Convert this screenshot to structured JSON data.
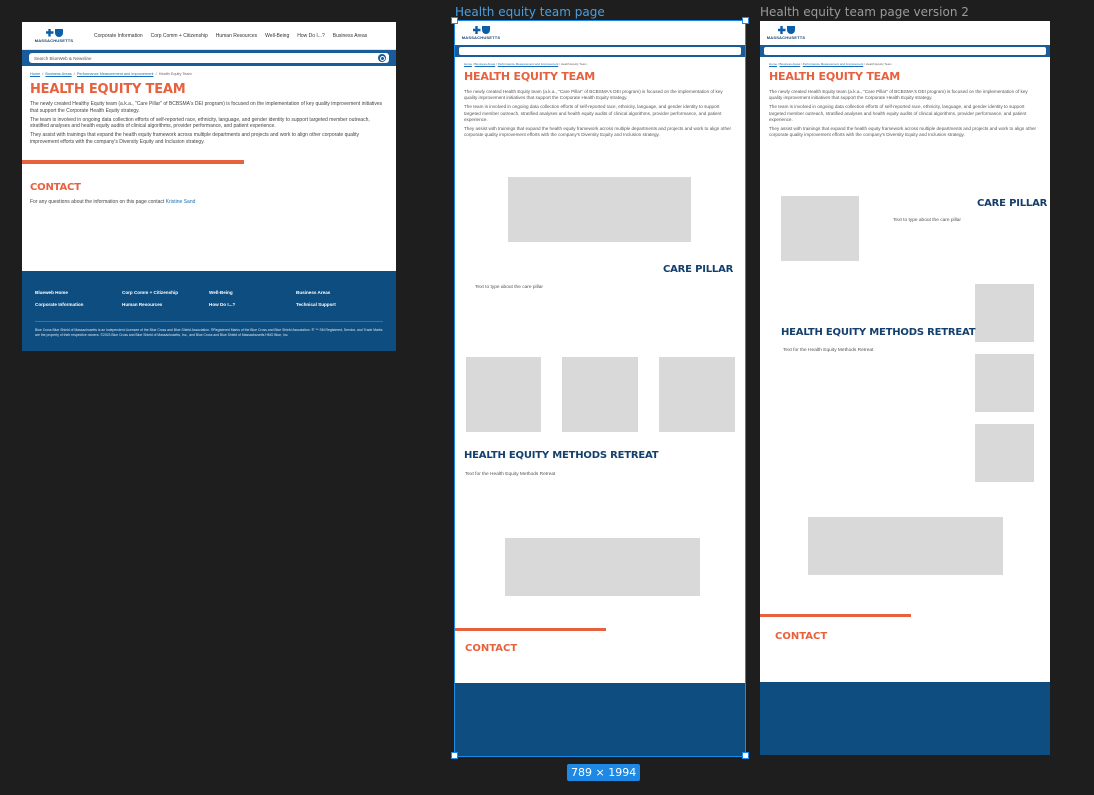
{
  "frames": {
    "f1": {
      "label": ""
    },
    "f2": {
      "label": "Health equity team page"
    },
    "f3": {
      "label": "Health equity team page version 2"
    }
  },
  "selection_size": "789 × 1994",
  "site": {
    "logo_text": "MASSACHUSETTS",
    "nav": [
      "Corporate Information",
      "Corp Comm + Citizenship",
      "Human Resources",
      "Well-Being",
      "How Do I...?",
      "Business Areas"
    ],
    "search_placeholder": "Search BlueWeb & Newsline",
    "breadcrumbs": [
      "Home",
      "Business Areas",
      "Performance Measurement and Improvement",
      "Health Equity Team"
    ],
    "title": "HEALTH EQUITY TEAM",
    "paragraphs": [
      "The newly created Healthy Equity team (a.k.a., \"Care Pillar\" of BCBSMA's DEI program) is focused on the implementation of key quality improvement initiatives that support the Corporate Health Equity strategy.",
      "The team is involved in ongoing data collection efforts of self-reported race, ethnicity, language, and gender identity to support targeted member outreach, stratified analyses and health equity audits of clinical algorithms, provider performance, and patient experience.",
      "They assist with trainings that expand the health equity framework across multiple departments and projects and work to align other corporate quality improvement efforts with the company's Diversity Equity and Inclusion strategy."
    ],
    "mobile_paragraphs": [
      "The newly created Health Equity team (a.k.a., \"Care Pillar\" of BCBSMA's DEI program) is focused on the implementation of key quality improvement initiatives that support the Corporate Health Equity strategy.",
      "The team is involved in ongoing data collection efforts of self-reported race, ethnicity, language, and gender identity to support targeted member outreach, stratified analyses and health equity audits of clinical algorithms, provider performance, and patient experience.",
      "They assist with trainings that expand the health equity framework across multiple departments and projects and work to align other corporate quality improvement efforts with the company's Diversity Equity and Inclusion strategy."
    ],
    "contact_heading": "CONTACT",
    "contact_prefix": "For any questions about the information on this page contact ",
    "contact_name": "Kristine Sand",
    "care_pillar_heading": "CARE PILLAR",
    "care_pillar_text": "Text to type about the care pillar",
    "retreat_heading": "HEALTH EQUITY METHODS RETREAT",
    "retreat_text": "Text for the Health Equity Methods Retreat",
    "footer_links": [
      "Blueweb Home",
      "Corp Comm + Citizenship",
      "Well-Being",
      "Business Areas",
      "Corporate Information",
      "Human Resources",
      "How Do I...?",
      "Technical Support"
    ],
    "footer_legal": "Blue Cross Blue Shield of Massachusetts is an independent Licensee of the Blue Cross and Blue Shield Association. ®Registered Marks of the Blue Cross and Blue Shield Association. ®´™ SM Registered, Service, and Trade Marks are the property of their respective owners. ©2023 Blue Cross and Blue Shield of Massachusetts, Inc., and Blue Cross and Blue Shield of Massachusetts HMO Blue, Inc."
  },
  "colors": {
    "canvas": "#1e1e1e",
    "brand_blue": "#0e4d80",
    "accent_orange": "#e8613d",
    "selection": "#1e88e5",
    "placeholder": "#d9d9d9"
  }
}
